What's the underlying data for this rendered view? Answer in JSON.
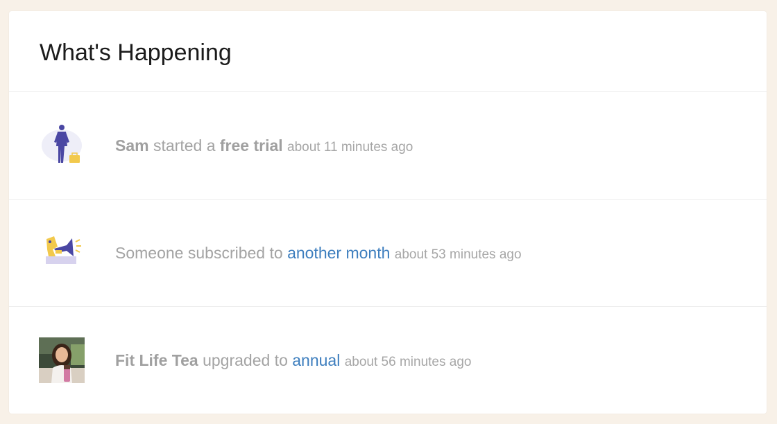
{
  "card": {
    "title": "What's Happening"
  },
  "feed": [
    {
      "icon": "businessperson-icon",
      "actor": "Sam",
      "verb": "started a",
      "object": "free trial",
      "timestamp": "about 11 minutes ago"
    },
    {
      "icon": "megaphone-icon",
      "actor": "Someone",
      "verb": "subscribed to",
      "object": "another month",
      "timestamp": "about 53 minutes ago"
    },
    {
      "icon": "avatar-photo",
      "actor": "Fit Life Tea",
      "verb": "upgraded to",
      "object": "annual",
      "timestamp": "about 56 minutes ago"
    }
  ],
  "colors": {
    "page_background": "#f8f1e8",
    "link": "#3d7ebe",
    "muted_text": "#a3a3a3",
    "illustration_purple": "#4a47a3",
    "illustration_yellow": "#f2c94c"
  }
}
